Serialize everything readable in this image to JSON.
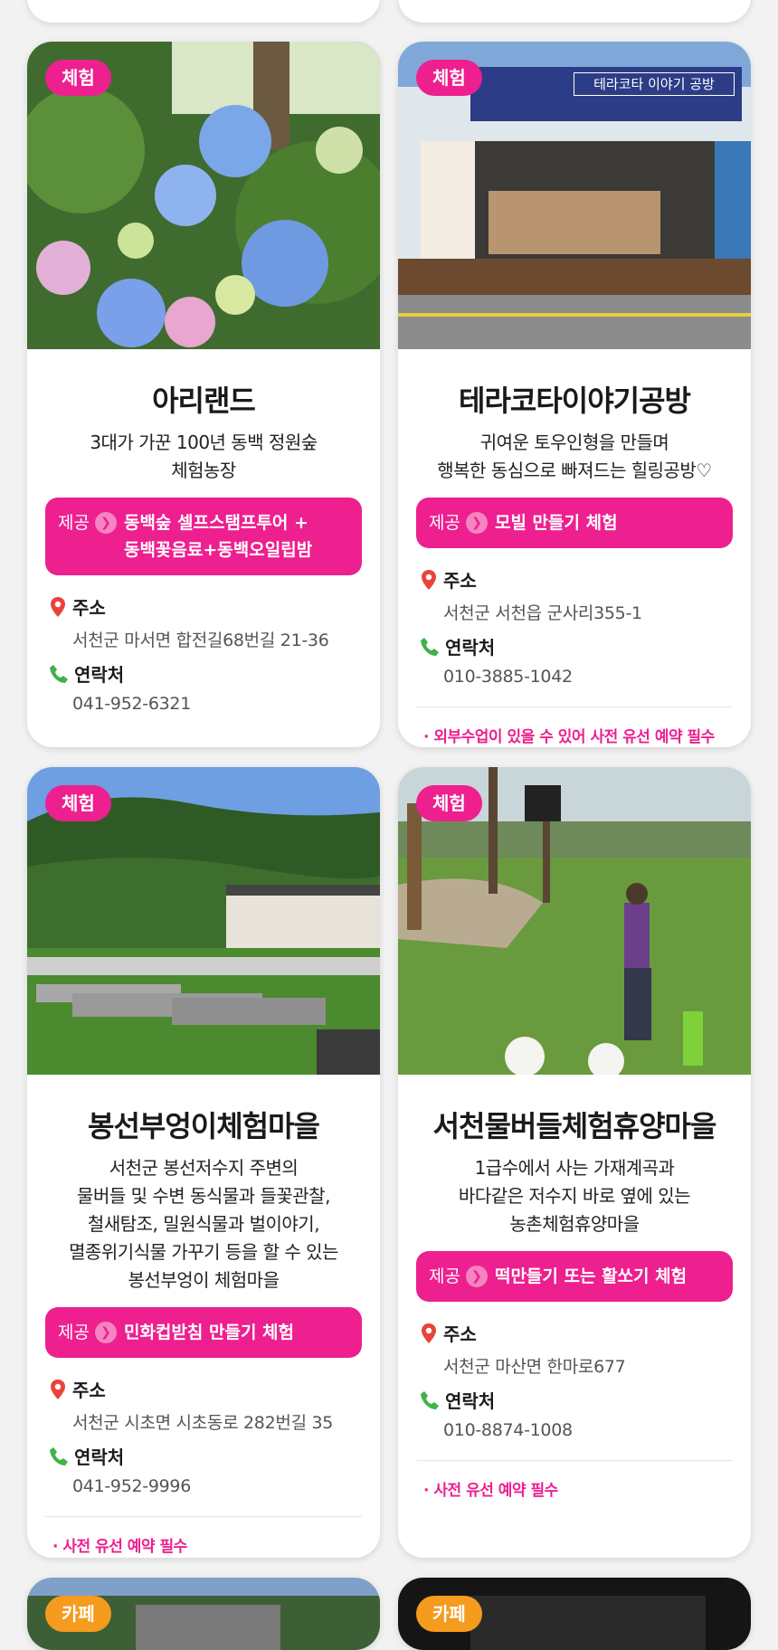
{
  "cards": [
    {
      "badge": "체험",
      "title": "아리랜드",
      "desc": "3대가 가꾼 100년 동백 정원숲\n체험농장",
      "offer_label": "제공",
      "offer": "동백숲 셀프스탬프투어 +\n동백꽃음료+동백오일립밤",
      "address_label": "주소",
      "address": "서천군 마서면 합전길68번길 21-36",
      "contact_label": "연락처",
      "contact": "041-952-6321",
      "note": ""
    },
    {
      "badge": "체험",
      "sign": "테라코타 이야기 공방",
      "title": "테라코타이야기공방",
      "desc": "귀여운 토우인형을 만들며\n행복한 동심으로 빠져드는 힐링공방♡",
      "offer_label": "제공",
      "offer": "모빌 만들기 체험",
      "address_label": "주소",
      "address": "서천군 서천읍 군사리355-1",
      "contact_label": "연락처",
      "contact": "010-3885-1042",
      "note": "· 외부수업이 있을 수 있어 사전 유선 예약 필수"
    },
    {
      "badge": "체험",
      "title": "봉선부엉이체험마을",
      "desc": "서천군 봉선저수지 주변의\n물버들 및 수변 동식물과 들꽃관찰,\n철새탐조, 밀원식물과 벌이야기,\n멸종위기식물 가꾸기 등을 할 수 있는\n봉선부엉이 체험마을",
      "offer_label": "제공",
      "offer": "민화컵받침 만들기 체험",
      "address_label": "주소",
      "address": "서천군 시초면 시초동로 282번길 35",
      "contact_label": "연락처",
      "contact": "041-952-9996",
      "note": "· 사전 유선 예약 필수"
    },
    {
      "badge": "체험",
      "title": "서천물버들체험휴양마을",
      "desc": "1급수에서 사는 가재계곡과\n바다같은 저수지 바로 옆에 있는\n농촌체험휴양마을",
      "offer_label": "제공",
      "offer": "떡만들기 또는 활쏘기 체험",
      "address_label": "주소",
      "address": "서천군 마산면 한마로677",
      "contact_label": "연락처",
      "contact": "010-8874-1008",
      "note": "· 사전 유선 예약 필수"
    }
  ],
  "bottom_badges": [
    "카페",
    "카페"
  ],
  "colors": {
    "accent": "#ee1f8f",
    "cafe": "#f59b1d"
  }
}
